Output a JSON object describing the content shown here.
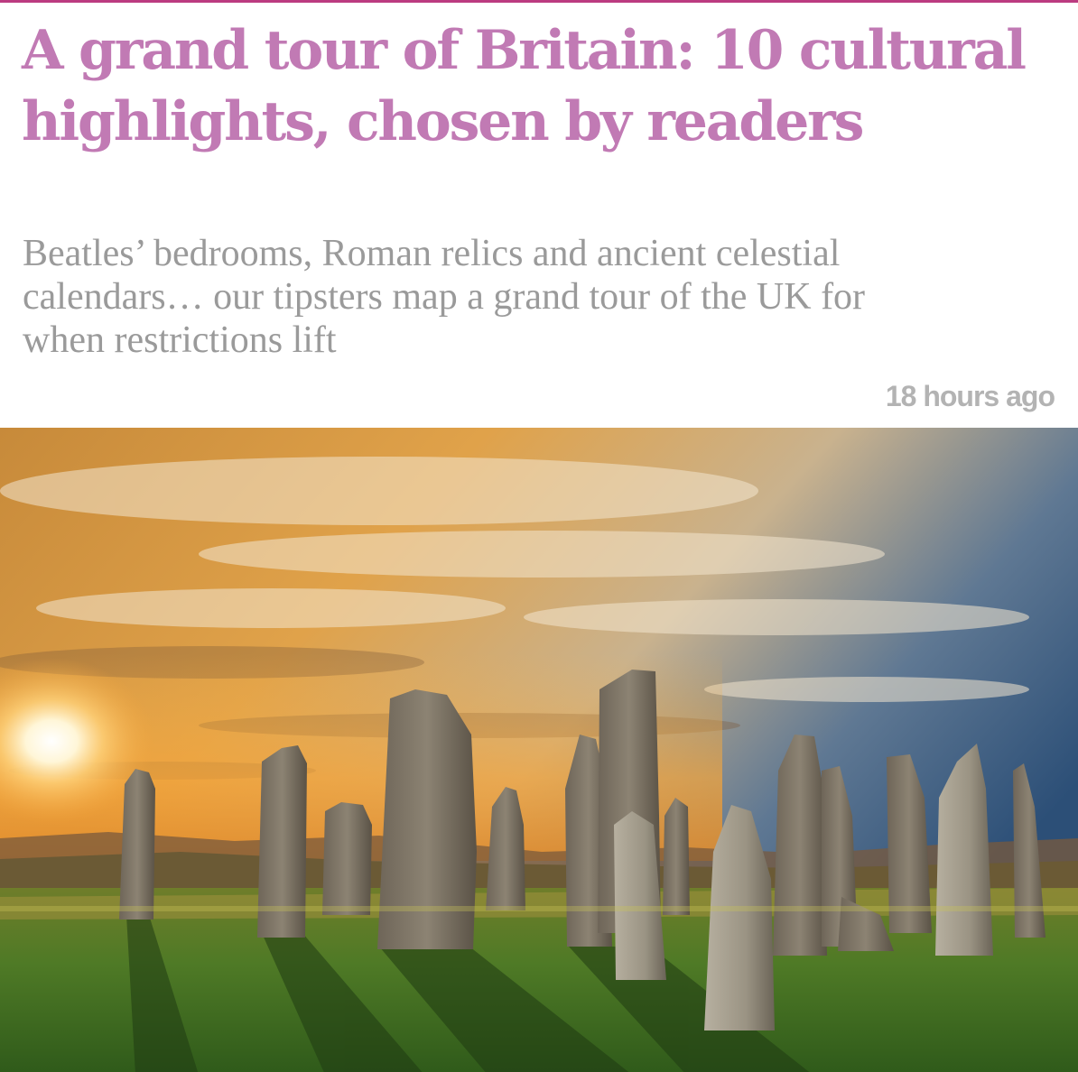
{
  "article": {
    "headline": "A grand tour of Britain: 10 cultural highlights, chosen by readers",
    "standfirst": "Beatles’ bedrooms, Roman relics and ancient celestial calendars… our tipsters map a grand tour of the UK for when restrictions lift",
    "timestamp": "18 hours ago"
  },
  "image": {
    "subject": "standing stones at sunset"
  },
  "colors": {
    "headline": "#c17ab4",
    "standfirst": "#9a9a9a",
    "timestamp": "#b3b3b3",
    "top_rule": "#bb3b80"
  }
}
